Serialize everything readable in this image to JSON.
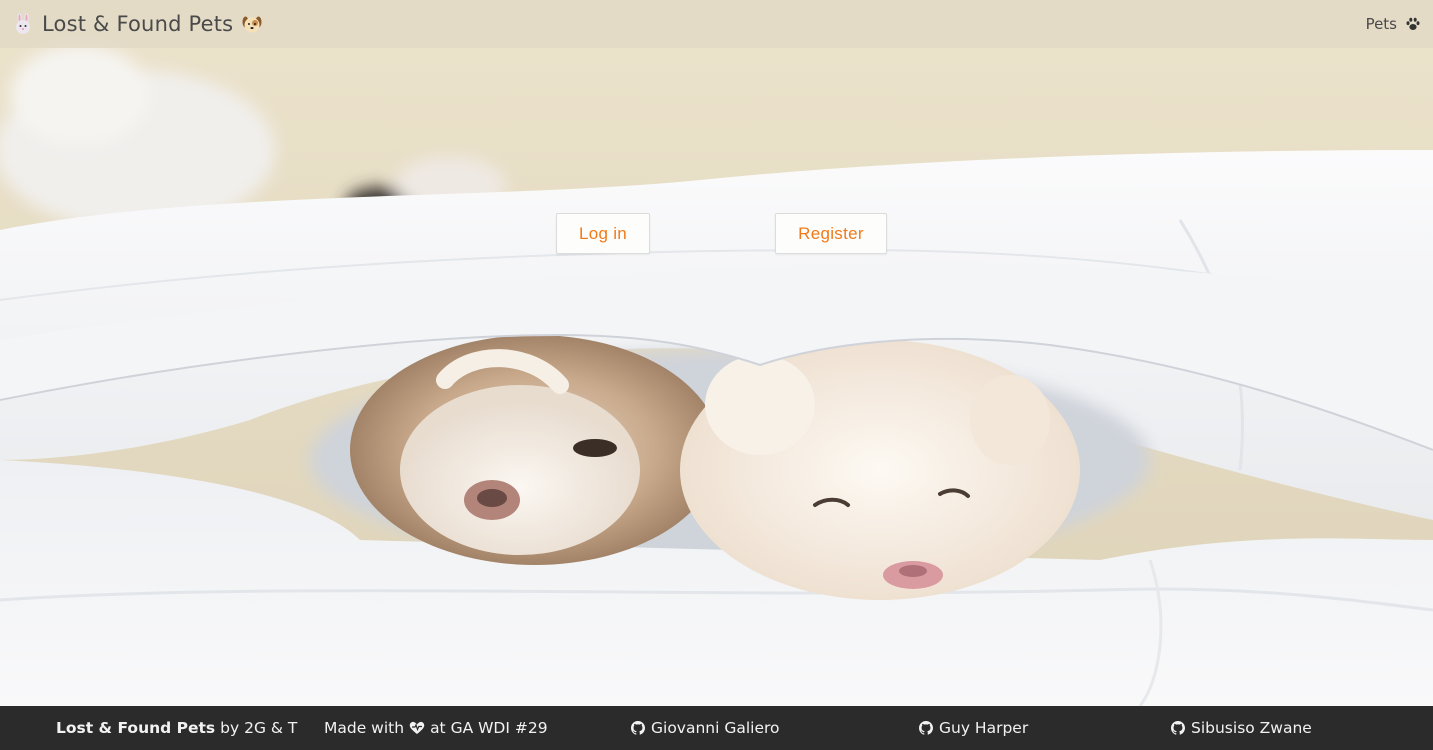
{
  "navbar": {
    "brand_text": "Lost & Found Pets",
    "brand_left_icon": "rabbit-emoji-icon",
    "brand_right_icon": "dog-emoji-icon",
    "pets_link": "Pets",
    "pets_icon": "paw-icon"
  },
  "hero": {
    "background": "two-puppies-under-blanket-image",
    "login_label": "Log in",
    "register_label": "Register"
  },
  "footer": {
    "app_name": "Lost & Found Pets",
    "by_text": "by 2G & T",
    "made_with": "Made with",
    "heart_icon": "heart-icon",
    "at_text": "at GA WDI #29",
    "developers": [
      {
        "name": "Giovanni Galiero",
        "icon": "github-icon"
      },
      {
        "name": "Guy Harper",
        "icon": "github-icon"
      },
      {
        "name": "Sibusiso Zwane",
        "icon": "github-icon"
      }
    ]
  },
  "colors": {
    "accent": "#f07a1a",
    "navbar_bg": "#e2dac6",
    "footer_bg": "#2b2b2b",
    "footer_text": "#f2f2f2"
  }
}
